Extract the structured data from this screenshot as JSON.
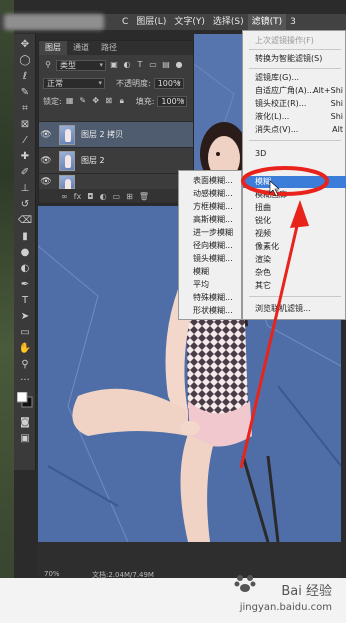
{
  "menubar": {
    "items": [
      "C",
      "图层(L)",
      "文字(Y)",
      "选择(S)",
      "滤镜(T)",
      "3"
    ],
    "active_index": 4
  },
  "layers_panel": {
    "tabs": [
      "图层",
      "通道",
      "路径"
    ],
    "kind_filter": "类型",
    "blend_mode": "正常",
    "opacity_label": "不透明度:",
    "opacity_value": "100%",
    "lock_label": "锁定:",
    "fill_label": "填充:",
    "fill_value": "100%",
    "layers": [
      {
        "name": "图层 2 拷贝",
        "selected": true
      },
      {
        "name": "图层 2",
        "selected": false
      }
    ],
    "bottom_icons": [
      "link-icon",
      "fx-icon",
      "mask-icon",
      "adjustment-icon",
      "group-icon",
      "new-layer-icon",
      "trash-icon"
    ],
    "fx_label": "fx"
  },
  "filter_menu": {
    "items": [
      {
        "label": "上次滤镜操作(F)",
        "shortcut": "",
        "disabled": true
      },
      {
        "label": "转换为智能滤镜(S)",
        "shortcut": "",
        "disabled": false
      },
      {
        "label": "滤镜库(G)...",
        "shortcut": "",
        "disabled": false
      },
      {
        "label": "自适应广角(A)...",
        "shortcut": "Alt+Shi",
        "disabled": false
      },
      {
        "label": "镜头校正(R)...",
        "shortcut": "Shi",
        "disabled": false
      },
      {
        "label": "液化(L)...",
        "shortcut": "Shi",
        "disabled": false
      },
      {
        "label": "消失点(V)...",
        "shortcut": "Alt",
        "disabled": false
      },
      {
        "label": "3D",
        "shortcut": "",
        "disabled": false
      },
      {
        "label": "模糊",
        "shortcut": "",
        "disabled": false,
        "highlighted": true
      },
      {
        "label": "模糊画廊",
        "shortcut": "",
        "disabled": false
      },
      {
        "label": "扭曲",
        "shortcut": "",
        "disabled": false
      },
      {
        "label": "锐化",
        "shortcut": "",
        "disabled": false
      },
      {
        "label": "视频",
        "shortcut": "",
        "disabled": false
      },
      {
        "label": "像素化",
        "shortcut": "",
        "disabled": false
      },
      {
        "label": "渲染",
        "shortcut": "",
        "disabled": false
      },
      {
        "label": "杂色",
        "shortcut": "",
        "disabled": false
      },
      {
        "label": "其它",
        "shortcut": "",
        "disabled": false
      },
      {
        "label": "浏览联机滤镜...",
        "shortcut": "",
        "disabled": false
      }
    ]
  },
  "blur_submenu": {
    "items": [
      "表面模糊...",
      "动感模糊...",
      "方框模糊...",
      "高斯模糊...",
      "进一步模糊",
      "径向模糊...",
      "镜头模糊...",
      "模糊",
      "平均",
      "特殊模糊...",
      "形状模糊..."
    ]
  },
  "status": {
    "zoom": "70%",
    "doc": "文档:2.04M/7.49M"
  },
  "watermark": {
    "brand": "Bai 经验",
    "url": "jingyan.baidu.com"
  },
  "colors": {
    "menu_highlight": "#3b7dd8",
    "annotation_red": "#e8231c",
    "canvas_blue": "#4d6ca6"
  }
}
